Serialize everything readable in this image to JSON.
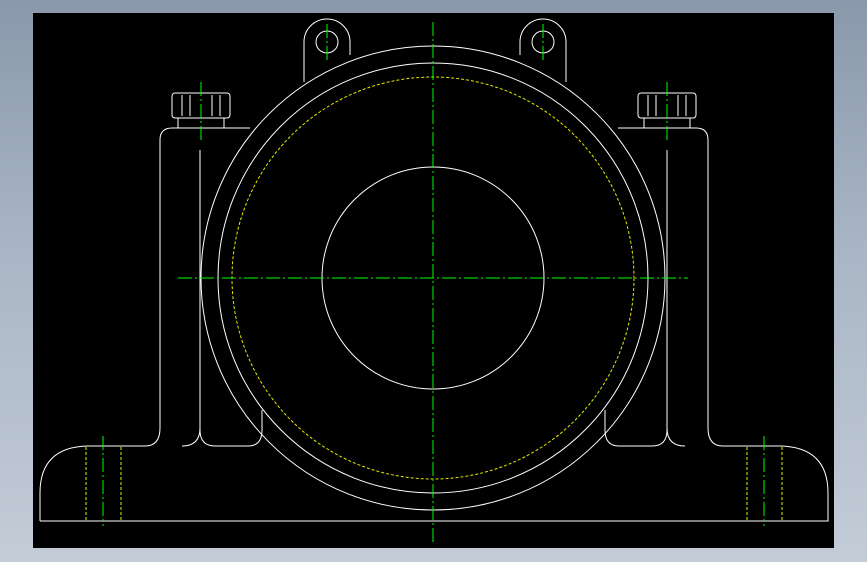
{
  "drawing": {
    "background": "#000000",
    "object_line_color": "#ffffff",
    "center_line_color": "#00ff00",
    "hidden_line_color": "#e8e800",
    "subject": "pillow-block-bearing-housing-front-view"
  }
}
